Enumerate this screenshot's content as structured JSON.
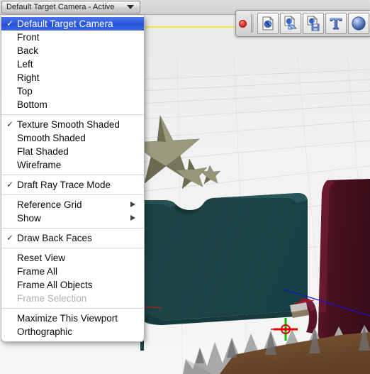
{
  "window": {
    "viewport_label": "Default Target Camera - Active",
    "dropdown_arrow_icon": "chevron-down-icon"
  },
  "menu": {
    "groups": [
      {
        "items": [
          {
            "label": "Default Target Camera",
            "checked": true,
            "selected": true,
            "disabled": false,
            "submenu": false
          },
          {
            "label": "Front",
            "checked": false,
            "selected": false,
            "disabled": false,
            "submenu": false
          },
          {
            "label": "Back",
            "checked": false,
            "selected": false,
            "disabled": false,
            "submenu": false
          },
          {
            "label": "Left",
            "checked": false,
            "selected": false,
            "disabled": false,
            "submenu": false
          },
          {
            "label": "Right",
            "checked": false,
            "selected": false,
            "disabled": false,
            "submenu": false
          },
          {
            "label": "Top",
            "checked": false,
            "selected": false,
            "disabled": false,
            "submenu": false
          },
          {
            "label": "Bottom",
            "checked": false,
            "selected": false,
            "disabled": false,
            "submenu": false
          }
        ]
      },
      {
        "items": [
          {
            "label": "Texture Smooth Shaded",
            "checked": true,
            "selected": false,
            "disabled": false,
            "submenu": false
          },
          {
            "label": "Smooth Shaded",
            "checked": false,
            "selected": false,
            "disabled": false,
            "submenu": false
          },
          {
            "label": "Flat Shaded",
            "checked": false,
            "selected": false,
            "disabled": false,
            "submenu": false
          },
          {
            "label": "Wireframe",
            "checked": false,
            "selected": false,
            "disabled": false,
            "submenu": false
          }
        ]
      },
      {
        "items": [
          {
            "label": "Draft Ray Trace Mode",
            "checked": true,
            "selected": false,
            "disabled": false,
            "submenu": false
          }
        ]
      },
      {
        "items": [
          {
            "label": "Reference Grid",
            "checked": false,
            "selected": false,
            "disabled": false,
            "submenu": true
          },
          {
            "label": "Show",
            "checked": false,
            "selected": false,
            "disabled": false,
            "submenu": true
          }
        ]
      },
      {
        "items": [
          {
            "label": "Draw Back Faces",
            "checked": true,
            "selected": false,
            "disabled": false,
            "submenu": false
          }
        ]
      },
      {
        "items": [
          {
            "label": "Reset View",
            "checked": false,
            "selected": false,
            "disabled": false,
            "submenu": false
          },
          {
            "label": "Frame All",
            "checked": false,
            "selected": false,
            "disabled": false,
            "submenu": false
          },
          {
            "label": "Frame All Objects",
            "checked": false,
            "selected": false,
            "disabled": false,
            "submenu": false
          },
          {
            "label": "Frame Selection",
            "checked": false,
            "selected": false,
            "disabled": true,
            "submenu": false
          }
        ]
      },
      {
        "items": [
          {
            "label": "Maximize This Viewport",
            "checked": false,
            "selected": false,
            "disabled": false,
            "submenu": false
          },
          {
            "label": "Orthographic",
            "checked": false,
            "selected": false,
            "disabled": false,
            "submenu": false
          }
        ]
      }
    ],
    "check_glyph": "✓",
    "submenu_glyph": "▶"
  },
  "toolbar": {
    "close_icon": "close-dot-icon",
    "buttons": [
      {
        "icon": "new-document-icon",
        "tooltip": "New"
      },
      {
        "icon": "open-document-icon",
        "tooltip": "Open"
      },
      {
        "icon": "save-document-icon",
        "tooltip": "Save"
      },
      {
        "icon": "text-tool-icon",
        "tooltip": "Text"
      },
      {
        "icon": "sphere-primitive-icon",
        "tooltip": "Sphere"
      }
    ]
  },
  "viewport": {
    "guide_line_color": "#f2e400",
    "axis_x_color": "#e00000",
    "axis_z_color": "#1010d8",
    "axis_y_color": "#00c000",
    "object_teal_color": "#1d4447",
    "object_maroon_color": "#4a1020",
    "object_star_color": "#8d8d6e",
    "object_brown_color": "#6e4a2c",
    "object_gray_color": "#9a9a9a",
    "grid_color": "#c9c9c9",
    "background_color": "#f1f1f1",
    "gizmo_name": "transform-crosshair-gizmo"
  }
}
